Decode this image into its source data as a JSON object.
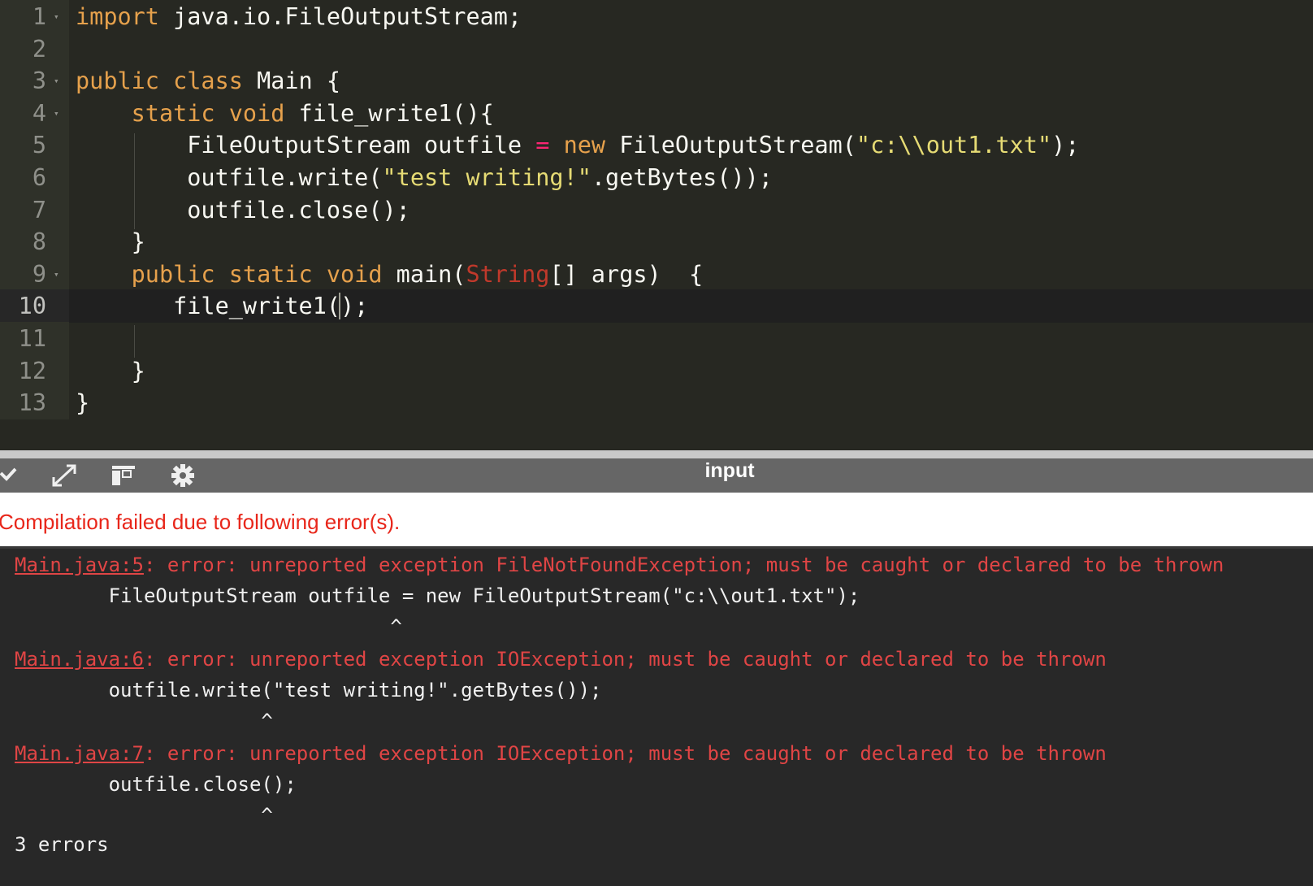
{
  "editor": {
    "lines": [
      {
        "num": "1",
        "fold": true,
        "tokens": [
          {
            "t": "import",
            "c": "kd"
          },
          {
            "t": " java.io.FileOutputStream;",
            "c": ""
          }
        ]
      },
      {
        "num": "2",
        "fold": false,
        "tokens": []
      },
      {
        "num": "3",
        "fold": true,
        "tokens": [
          {
            "t": "public class",
            "c": "kd"
          },
          {
            "t": " Main {",
            "c": ""
          }
        ]
      },
      {
        "num": "4",
        "fold": true,
        "tokens": [
          {
            "t": "    ",
            "c": ""
          },
          {
            "t": "static void",
            "c": "kd"
          },
          {
            "t": " file_write1(){",
            "c": ""
          }
        ]
      },
      {
        "num": "5",
        "fold": false,
        "tokens": [
          {
            "t": "        FileOutputStream outfile ",
            "c": ""
          },
          {
            "t": "=",
            "c": "op"
          },
          {
            "t": " ",
            "c": ""
          },
          {
            "t": "new",
            "c": "kd"
          },
          {
            "t": " FileOutputStream(",
            "c": ""
          },
          {
            "t": "\"c:\\\\out1.txt\"",
            "c": "str"
          },
          {
            "t": ");",
            "c": ""
          }
        ]
      },
      {
        "num": "6",
        "fold": false,
        "tokens": [
          {
            "t": "        outfile.write(",
            "c": ""
          },
          {
            "t": "\"test writing!\"",
            "c": "str"
          },
          {
            "t": ".getBytes());",
            "c": ""
          }
        ]
      },
      {
        "num": "7",
        "fold": false,
        "tokens": [
          {
            "t": "        outfile.close();",
            "c": ""
          }
        ]
      },
      {
        "num": "8",
        "fold": false,
        "tokens": [
          {
            "t": "    }",
            "c": ""
          }
        ]
      },
      {
        "num": "9",
        "fold": true,
        "tokens": [
          {
            "t": "    ",
            "c": ""
          },
          {
            "t": "public static void",
            "c": "kd"
          },
          {
            "t": " main(",
            "c": ""
          },
          {
            "t": "String",
            "c": "cls"
          },
          {
            "t": "[] args)  {",
            "c": ""
          }
        ]
      },
      {
        "num": "10",
        "fold": false,
        "active": true,
        "tokens": [
          {
            "t": "       file_write1();",
            "c": ""
          }
        ]
      },
      {
        "num": "11",
        "fold": false,
        "tokens": []
      },
      {
        "num": "12",
        "fold": false,
        "tokens": [
          {
            "t": "    }",
            "c": ""
          }
        ]
      },
      {
        "num": "13",
        "fold": false,
        "tokens": [
          {
            "t": "}",
            "c": ""
          }
        ]
      }
    ]
  },
  "toolbar": {
    "title": "input",
    "icons": [
      "chevron-down-icon",
      "expand-icon",
      "layout-icon",
      "gear-icon"
    ]
  },
  "status": {
    "message": "Compilation failed due to following error(s)."
  },
  "output": {
    "errors": [
      {
        "link": "Main.java:5",
        "message": ": error: unreported exception FileNotFoundException; must be caught or declared to be thrown",
        "source": "        FileOutputStream outfile = new FileOutputStream(\"c:\\\\out1.txt\");",
        "caret": "                                ^"
      },
      {
        "link": "Main.java:6",
        "message": ": error: unreported exception IOException; must be caught or declared to be thrown",
        "source": "        outfile.write(\"test writing!\".getBytes());",
        "caret": "                     ^"
      },
      {
        "link": "Main.java:7",
        "message": ": error: unreported exception IOException; must be caught or declared to be thrown",
        "source": "        outfile.close();",
        "caret": "                     ^"
      }
    ],
    "summary": "3 errors"
  },
  "colors": {
    "editor_bg": "#272822",
    "keyword": "#e6a14c",
    "string": "#e6db74",
    "error": "#e04545",
    "toolbar": "#666666"
  }
}
